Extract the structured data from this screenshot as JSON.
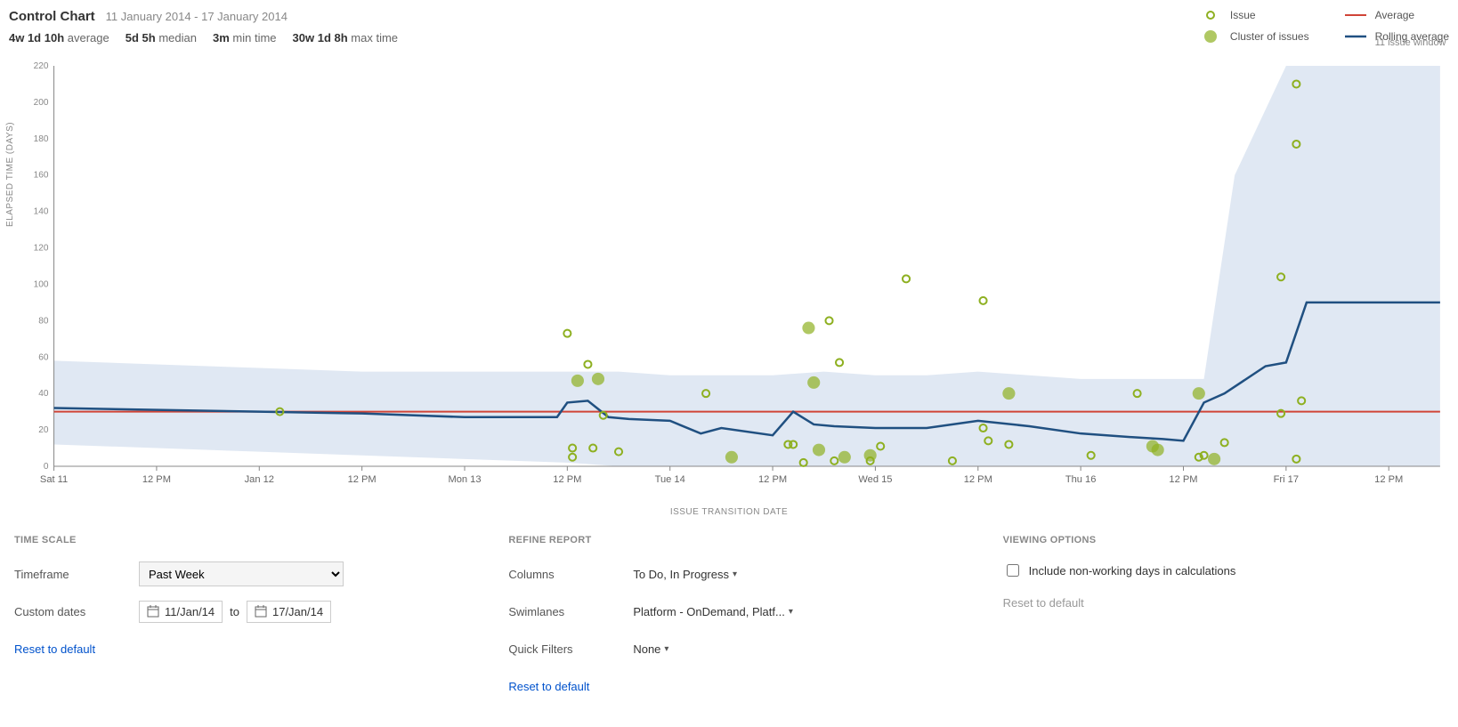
{
  "header": {
    "title": "Control Chart",
    "date_range": "11 January 2014 - 17 January 2014"
  },
  "stats": {
    "average_val": "4w 1d 10h",
    "average_lbl": "average",
    "median_val": "5d 5h",
    "median_lbl": "median",
    "min_val": "3m",
    "min_lbl": "min time",
    "max_val": "30w 1d 8h",
    "max_lbl": "max time"
  },
  "legend": {
    "issue": "Issue",
    "cluster": "Cluster of issues",
    "average": "Average",
    "rolling": "Rolling average",
    "rolling_sub": "11 issue window"
  },
  "chart_axes": {
    "ylabel": "ELAPSED TIME (DAYS)",
    "xlabel": "ISSUE TRANSITION DATE",
    "yticks": [
      0,
      20,
      40,
      60,
      80,
      100,
      120,
      140,
      160,
      180,
      200,
      220
    ],
    "xticks": [
      "Sat 11",
      "12 PM",
      "Jan 12",
      "12 PM",
      "Mon 13",
      "12 PM",
      "Tue 14",
      "12 PM",
      "Wed 15",
      "12 PM",
      "Thu 16",
      "12 PM",
      "Fri 17",
      "12 PM"
    ]
  },
  "chart_data": {
    "type": "scatter",
    "title": "Control Chart",
    "xlabel": "ISSUE TRANSITION DATE",
    "ylabel": "ELAPSED TIME (DAYS)",
    "ylim": [
      0,
      220
    ],
    "x_categories": [
      "Sat 11",
      "12 PM",
      "Jan 12",
      "12 PM",
      "Mon 13",
      "12 PM",
      "Tue 14",
      "12 PM",
      "Wed 15",
      "12 PM",
      "Thu 16",
      "12 PM",
      "Fri 17",
      "12 PM"
    ],
    "average": 30,
    "rolling_average": {
      "x": [
        0,
        1,
        2,
        3,
        4,
        4.9,
        5.0,
        5.2,
        5.4,
        5.6,
        6.0,
        6.3,
        6.5,
        7.0,
        7.2,
        7.4,
        7.6,
        8.0,
        8.5,
        9.0,
        9.5,
        10.0,
        10.5,
        10.8,
        11.0,
        11.2,
        11.4,
        11.8,
        12.0,
        12.2,
        12.5,
        13.0,
        13.5
      ],
      "y": [
        32,
        31,
        30,
        29,
        27,
        27,
        35,
        36,
        27,
        26,
        25,
        18,
        21,
        17,
        30,
        23,
        22,
        21,
        21,
        25,
        22,
        18,
        16,
        15,
        14,
        35,
        40,
        55,
        57,
        90,
        90,
        90,
        90
      ]
    },
    "std_band": {
      "x": [
        0,
        1,
        2,
        3,
        4,
        5,
        5.5,
        6,
        6.5,
        7,
        7.5,
        8,
        8.5,
        9,
        9.5,
        10,
        10.5,
        11,
        11.2,
        11.5,
        12,
        12.5,
        13,
        13.5
      ],
      "upper": [
        58,
        56,
        54,
        52,
        52,
        52,
        52,
        50,
        50,
        50,
        52,
        50,
        50,
        52,
        50,
        48,
        48,
        48,
        48,
        160,
        220,
        220,
        220,
        220
      ],
      "lower": [
        12,
        10,
        8,
        6,
        4,
        2,
        0,
        0,
        0,
        0,
        0,
        0,
        0,
        0,
        0,
        0,
        0,
        0,
        0,
        0,
        0,
        0,
        0,
        0
      ]
    },
    "series": [
      {
        "name": "Issue",
        "marker": "open-circle",
        "points": [
          {
            "x": 2.2,
            "y": 30
          },
          {
            "x": 5.0,
            "y": 73
          },
          {
            "x": 5.05,
            "y": 10
          },
          {
            "x": 5.2,
            "y": 56
          },
          {
            "x": 5.25,
            "y": 10
          },
          {
            "x": 5.05,
            "y": 5
          },
          {
            "x": 5.35,
            "y": 28
          },
          {
            "x": 5.5,
            "y": 8
          },
          {
            "x": 6.35,
            "y": 40
          },
          {
            "x": 7.15,
            "y": 12
          },
          {
            "x": 7.2,
            "y": 12
          },
          {
            "x": 7.3,
            "y": 2
          },
          {
            "x": 7.55,
            "y": 80
          },
          {
            "x": 7.65,
            "y": 57
          },
          {
            "x": 7.6,
            "y": 3
          },
          {
            "x": 7.95,
            "y": 3
          },
          {
            "x": 8.05,
            "y": 11
          },
          {
            "x": 8.3,
            "y": 103
          },
          {
            "x": 8.75,
            "y": 3
          },
          {
            "x": 9.05,
            "y": 21
          },
          {
            "x": 9.05,
            "y": 91
          },
          {
            "x": 9.1,
            "y": 14
          },
          {
            "x": 9.3,
            "y": 12
          },
          {
            "x": 10.1,
            "y": 6
          },
          {
            "x": 10.55,
            "y": 40
          },
          {
            "x": 11.15,
            "y": 5
          },
          {
            "x": 11.2,
            "y": 6
          },
          {
            "x": 11.4,
            "y": 13
          },
          {
            "x": 11.95,
            "y": 104
          },
          {
            "x": 11.95,
            "y": 29
          },
          {
            "x": 12.1,
            "y": 210
          },
          {
            "x": 12.1,
            "y": 177
          },
          {
            "x": 12.1,
            "y": 4
          },
          {
            "x": 12.15,
            "y": 36
          }
        ]
      },
      {
        "name": "Cluster of issues",
        "marker": "filled-circle",
        "points": [
          {
            "x": 5.1,
            "y": 47
          },
          {
            "x": 5.3,
            "y": 48
          },
          {
            "x": 6.6,
            "y": 5
          },
          {
            "x": 7.4,
            "y": 46
          },
          {
            "x": 7.35,
            "y": 76
          },
          {
            "x": 7.45,
            "y": 9
          },
          {
            "x": 7.7,
            "y": 5
          },
          {
            "x": 7.95,
            "y": 6
          },
          {
            "x": 9.3,
            "y": 40
          },
          {
            "x": 10.7,
            "y": 11
          },
          {
            "x": 10.75,
            "y": 9
          },
          {
            "x": 11.15,
            "y": 40
          },
          {
            "x": 11.3,
            "y": 4
          }
        ]
      }
    ]
  },
  "controls": {
    "timescale_hdr": "TIME SCALE",
    "refine_hdr": "REFINE REPORT",
    "viewing_hdr": "VIEWING OPTIONS",
    "timeframe_lbl": "Timeframe",
    "timeframe_val": "Past Week",
    "custom_lbl": "Custom dates",
    "date_from": "11/Jan/14",
    "date_to_sep": "to",
    "date_to": "17/Jan/14",
    "reset_link": "Reset to default",
    "columns_lbl": "Columns",
    "columns_val": "To Do, In Progress",
    "swimlanes_lbl": "Swimlanes",
    "swimlanes_val": "Platform - OnDemand, Platf...",
    "quick_lbl": "Quick Filters",
    "quick_val": "None",
    "nonworking_lbl": "Include non-working days in calculations"
  }
}
